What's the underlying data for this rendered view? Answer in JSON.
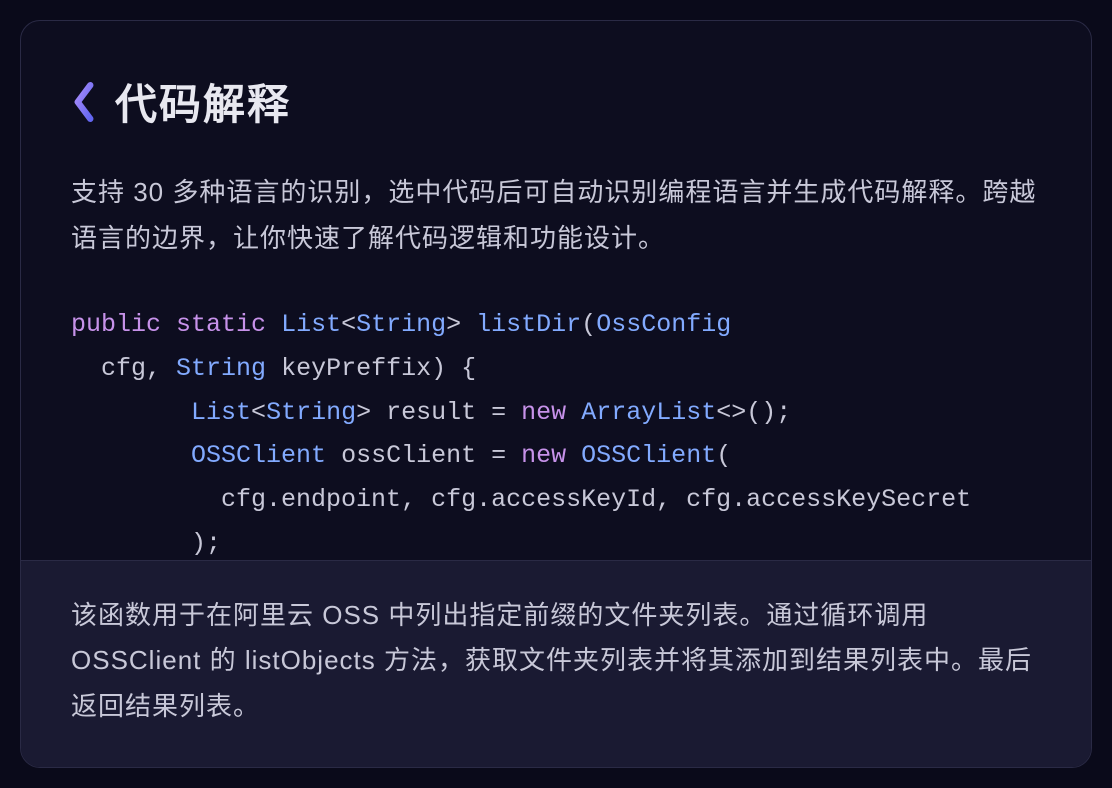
{
  "header": {
    "title": "代码解释",
    "icon": "chevron-left-icon"
  },
  "description": "支持 30 多种语言的识别，选中代码后可自动识别编程语言并生成代码解释。跨越语言的边界，让你快速了解代码逻辑和功能设计。",
  "code": {
    "tokens": {
      "public": "public",
      "static": "static",
      "list": "List",
      "string": "String",
      "listDir": "listDir",
      "ossConfig": "OssConfig",
      "cfg": "cfg",
      "keyPreffix": "keyPreffix",
      "result": "result",
      "new": "new",
      "arrayList": "ArrayList",
      "ossClient": "OSSClient",
      "ossClientVar": "ossClient",
      "endpoint": "cfg.endpoint",
      "accessKeyId": "cfg.accessKeyId",
      "accessKeySecret": "cfg.accessKeySecret"
    }
  },
  "footer": {
    "explanation": "该函数用于在阿里云 OSS 中列出指定前缀的文件夹列表。通过循环调用 OSSClient 的 listObjects 方法，获取文件夹列表并将其添加到结果列表中。最后返回结果列表。"
  }
}
